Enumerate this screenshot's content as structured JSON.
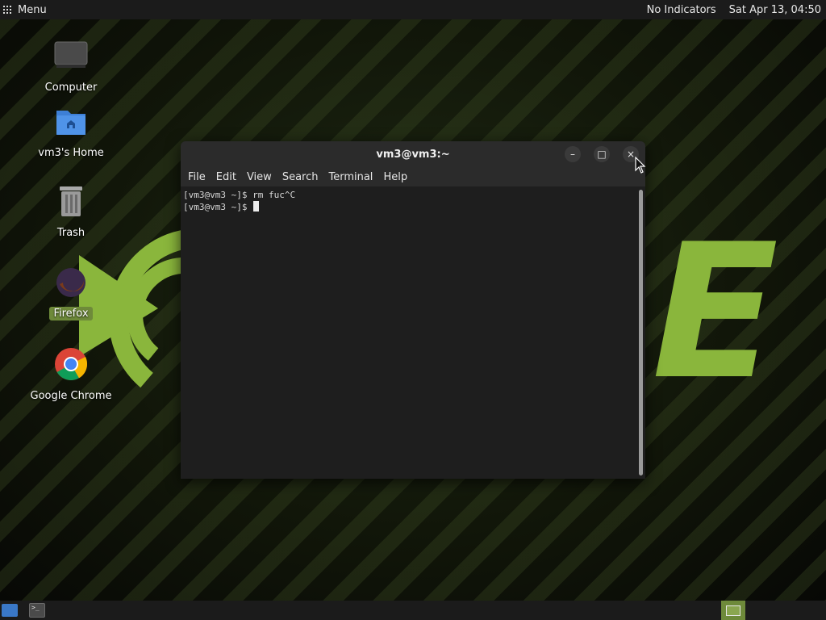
{
  "top_panel": {
    "menu_label": "Menu",
    "indicators": "No Indicators",
    "clock": "Sat Apr 13, 04:50"
  },
  "desktop_icons": [
    {
      "label": "Computer",
      "icon": "computer-icon"
    },
    {
      "label": "vm3's Home",
      "icon": "home-folder-icon"
    },
    {
      "label": "Trash",
      "icon": "trash-icon"
    },
    {
      "label": "Firefox",
      "icon": "firefox-icon",
      "selected": true
    },
    {
      "label": "Google Chrome",
      "icon": "chrome-icon"
    }
  ],
  "terminal": {
    "title": "vm3@vm3:~",
    "buttons": {
      "minimize": "–",
      "maximize": "□",
      "close": "×"
    },
    "menu": [
      "File",
      "Edit",
      "View",
      "Search",
      "Terminal",
      "Help"
    ],
    "lines": [
      "[vm3@vm3 ~]$ rm fuc^C",
      "[vm3@vm3 ~]$ "
    ]
  },
  "wallpaper_text": "E",
  "colors": {
    "accent": "#6e8a3a",
    "logo": "#8ab63c",
    "panel": "#1b1b1b"
  }
}
